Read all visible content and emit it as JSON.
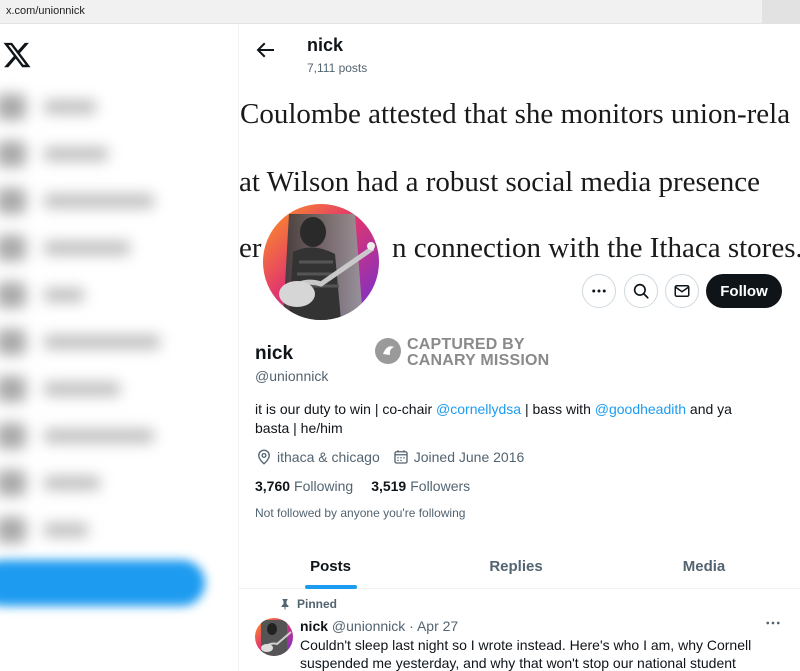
{
  "browser": {
    "url": "x.com/unionnick"
  },
  "sidebar": {
    "logo": "x-logo",
    "items_blurred": 10
  },
  "header": {
    "name": "nick",
    "post_count": "7,111 posts"
  },
  "banner": {
    "line1": "Coulombe attested that she monitors union-rela",
    "line2": "at Wilson had a robust social media presence",
    "line3": "er                  n connection with the Ithaca stores."
  },
  "actions": {
    "follow_label": "Follow"
  },
  "profile": {
    "name": "nick",
    "handle": "@unionnick",
    "bio_part1": "it is our duty to win | co-chair ",
    "bio_link1": "@cornellydsa",
    "bio_part2": " | bass with ",
    "bio_link2": "@goodheadith",
    "bio_part3": " and ya basta | he/him",
    "location": "ithaca & chicago",
    "joined": "Joined June 2016",
    "following_count": "3,760",
    "following_label": "Following",
    "followers_count": "3,519",
    "followers_label": "Followers",
    "not_followed": "Not followed by anyone you're following"
  },
  "watermark": {
    "line1": "CAPTURED BY",
    "line2": "CANARY MISSION"
  },
  "tabs": [
    {
      "label": "Posts",
      "active": true
    },
    {
      "label": "Replies",
      "active": false
    },
    {
      "label": "Media",
      "active": false
    }
  ],
  "pinned_post": {
    "pinned_label": "Pinned",
    "author": "nick",
    "handle_date": "@unionnick · Apr 27",
    "text": "Couldn't sleep last night so I wrote instead. Here's who I am, why Cornell suspended me yesterday, and why that won't stop our national student"
  },
  "colors": {
    "accent": "#1d9bf0",
    "text": "#0f1419",
    "secondary": "#536471",
    "follow_bg": "#0f1419"
  }
}
